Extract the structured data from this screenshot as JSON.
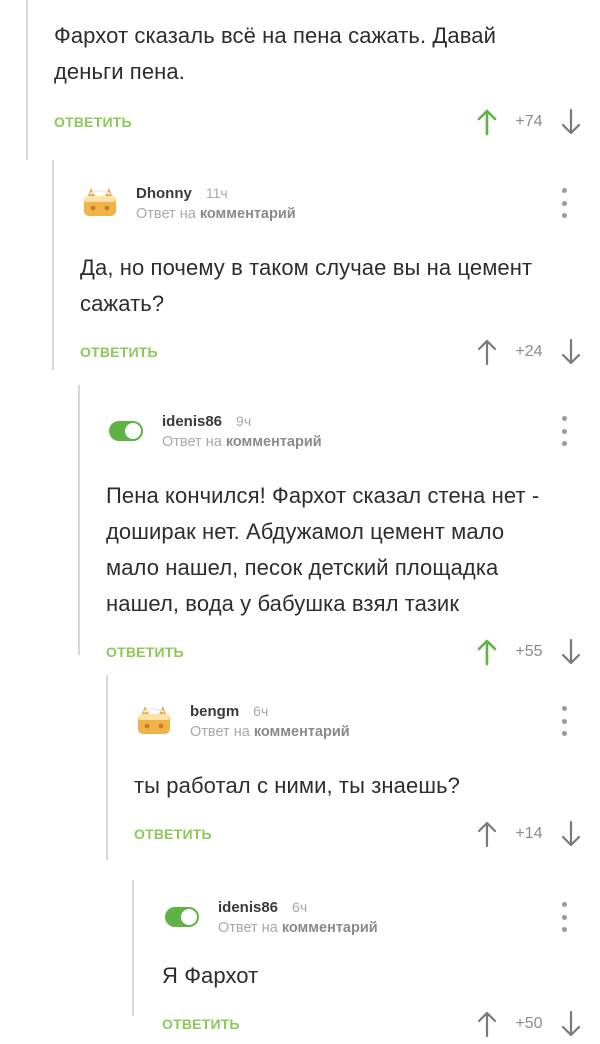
{
  "comments": [
    {
      "text": "Фархот сказаль всё на пена сажать. Давай деньги пена.",
      "reply_label": "ОТВЕТИТЬ",
      "rating": "+74",
      "upvoted": true
    },
    {
      "nick": "Dhonny",
      "time": "11ч",
      "reply_to_prefix": "Ответ на",
      "reply_to_target": "комментарий",
      "avatar": "cat-avatar-icon",
      "text": "Да, но почему в таком случае вы на цемент сажать?",
      "reply_label": "ОТВЕТИТЬ",
      "rating": "+24",
      "upvoted": false
    },
    {
      "nick": "idenis86",
      "time": "9ч",
      "reply_to_prefix": "Ответ на",
      "reply_to_target": "комментарий",
      "avatar": "toggle-avatar-icon",
      "text": "Пена кончился! Фархот сказал стена нет - доширак нет. Абдужамол цемент мало мало нашел, песок детский площадка нашел, вода у бабушка взял тазик",
      "reply_label": "ОТВЕТИТЬ",
      "rating": "+55",
      "upvoted": true
    },
    {
      "nick": "bengm",
      "time": "6ч",
      "reply_to_prefix": "Ответ на",
      "reply_to_target": "комментарий",
      "avatar": "cat-avatar-icon",
      "text": "ты работал с ними, ты знаешь?",
      "reply_label": "ОТВЕТИТЬ",
      "rating": "+14",
      "upvoted": false
    },
    {
      "nick": "idenis86",
      "time": "6ч",
      "reply_to_prefix": "Ответ на",
      "reply_to_target": "комментарий",
      "avatar": "toggle-avatar-icon",
      "text": "Я Фархот",
      "reply_label": "ОТВЕТИТЬ",
      "rating": "+50",
      "upvoted": false
    }
  ],
  "colors": {
    "accent_green": "#8ac858",
    "upvote_green": "#5fb244",
    "meta_gray": "#a8a8a8",
    "thread_line": "#d7d7d7"
  }
}
